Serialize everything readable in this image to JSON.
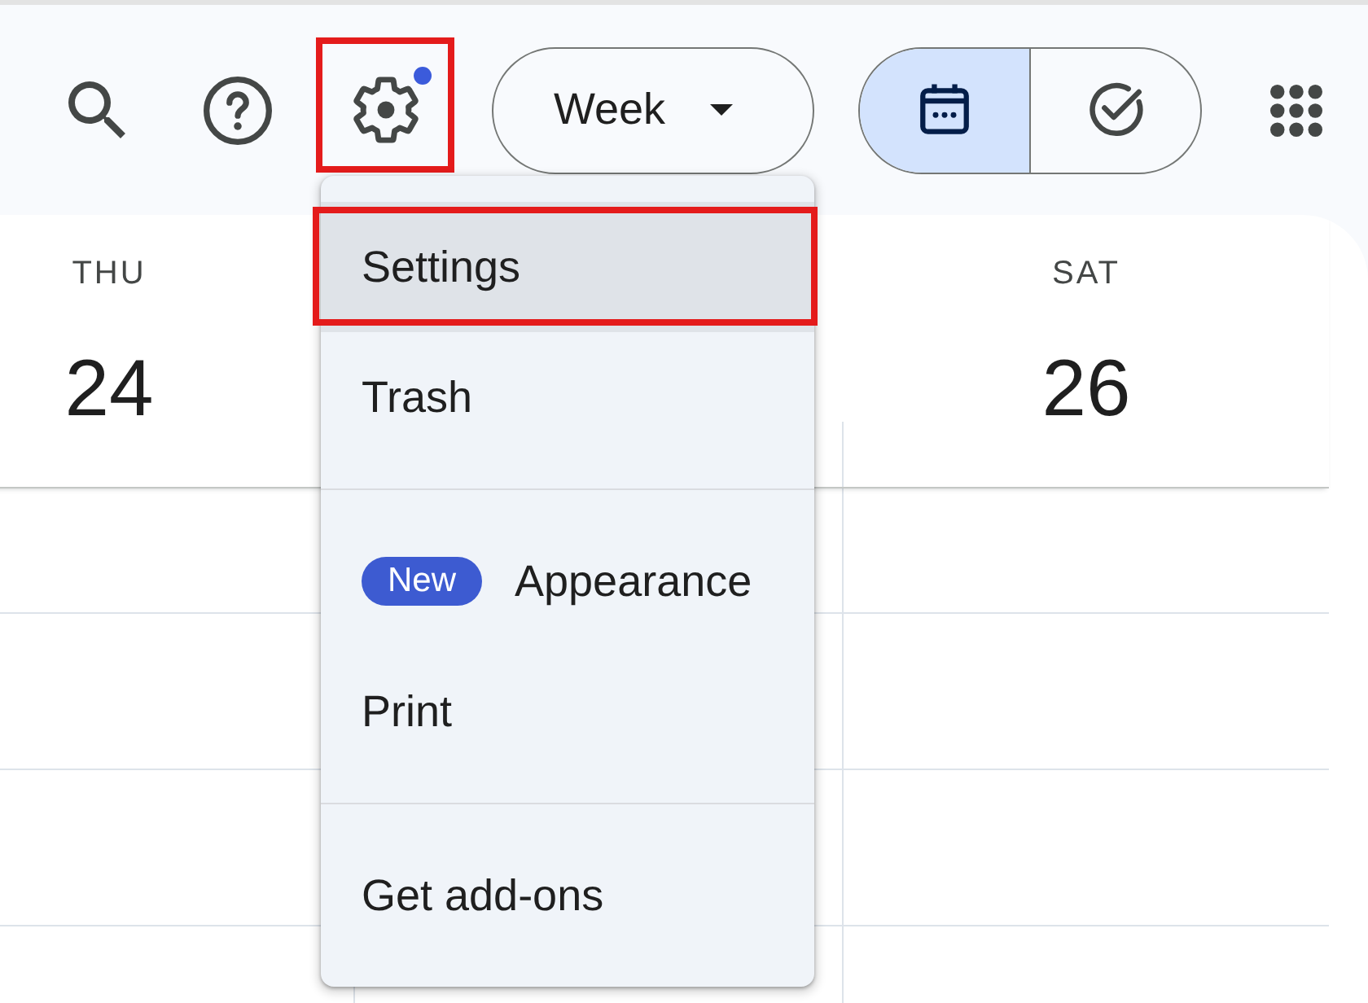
{
  "top_bar": {
    "settings_button": {
      "notification_dot": true,
      "annotated": true
    },
    "view_selector": {
      "label": "Week"
    },
    "view_toggle": [
      {
        "kind": "calendar",
        "selected": true
      },
      {
        "kind": "tasks",
        "selected": false
      }
    ]
  },
  "days": [
    {
      "weekday": "THU",
      "date": "24"
    },
    {
      "weekday": "SAT",
      "date": "26"
    }
  ],
  "settings_menu": {
    "sections": [
      {
        "items": [
          {
            "label": "Settings",
            "hovered": true,
            "annotated": true
          },
          {
            "label": "Trash",
            "hovered": false,
            "annotated": false
          }
        ]
      },
      {
        "items": [
          {
            "label": "Appearance",
            "badge": "New",
            "hovered": false,
            "annotated": false
          },
          {
            "label": "Print",
            "hovered": false,
            "annotated": false
          }
        ]
      },
      {
        "items": [
          {
            "label": "Get add-ons",
            "hovered": false,
            "annotated": false
          }
        ]
      }
    ]
  }
}
